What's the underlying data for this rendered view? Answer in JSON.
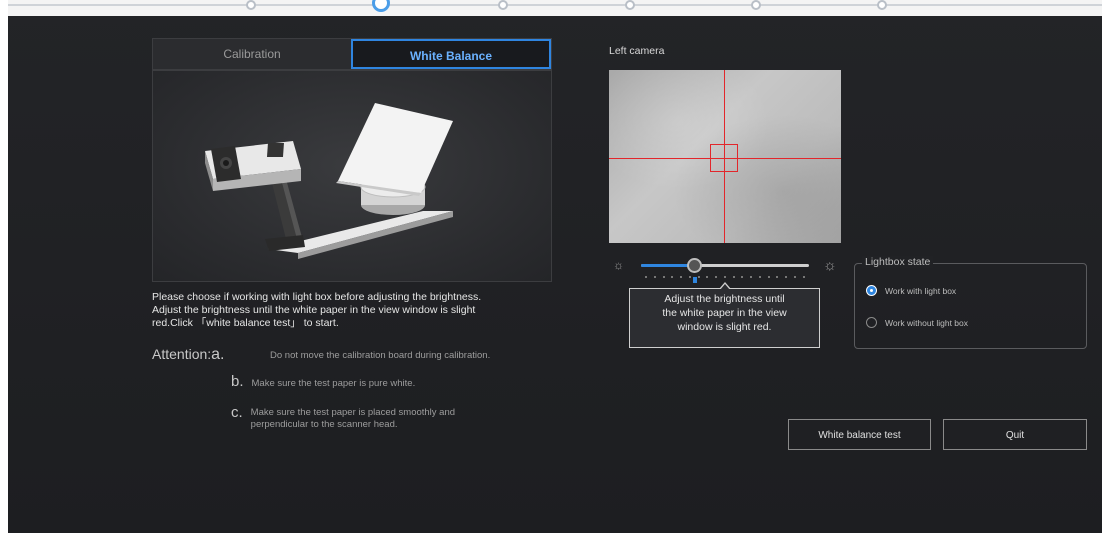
{
  "tabs": {
    "calibration": "Calibration",
    "white_balance": "White Balance"
  },
  "description": [
    "Please choose if working with light box before adjusting the brightness.",
    "Adjust the brightness until the white paper in the view window is slight",
    "red.Click 「white balance test」 to start."
  ],
  "attention": {
    "label": "Attention:",
    "items": [
      {
        "letter": "a.",
        "text": "Do not move the calibration board during calibration."
      },
      {
        "letter": "b.",
        "text": "Make sure the test paper is pure white."
      },
      {
        "letter": "c.",
        "lines": [
          "Make sure the test paper is placed smoothly and",
          "perpendicular to the scanner head."
        ]
      }
    ]
  },
  "camera": {
    "label": "Left camera"
  },
  "brightness": {
    "level": 0.32,
    "tooltip": [
      "Adjust the brightness until",
      "the white paper in the view",
      "window is slight red."
    ]
  },
  "lightbox": {
    "legend": "Lightbox state",
    "options": [
      {
        "label": "Work with light box",
        "selected": true
      },
      {
        "label": "Work without light box",
        "selected": false
      }
    ]
  },
  "buttons": {
    "test": "White balance test",
    "quit": "Quit"
  },
  "icons": {
    "dim": "sun-dim-icon",
    "bright": "sun-bright-icon"
  },
  "colors": {
    "accent": "#2f86e0",
    "crosshair": "#e2262b"
  }
}
